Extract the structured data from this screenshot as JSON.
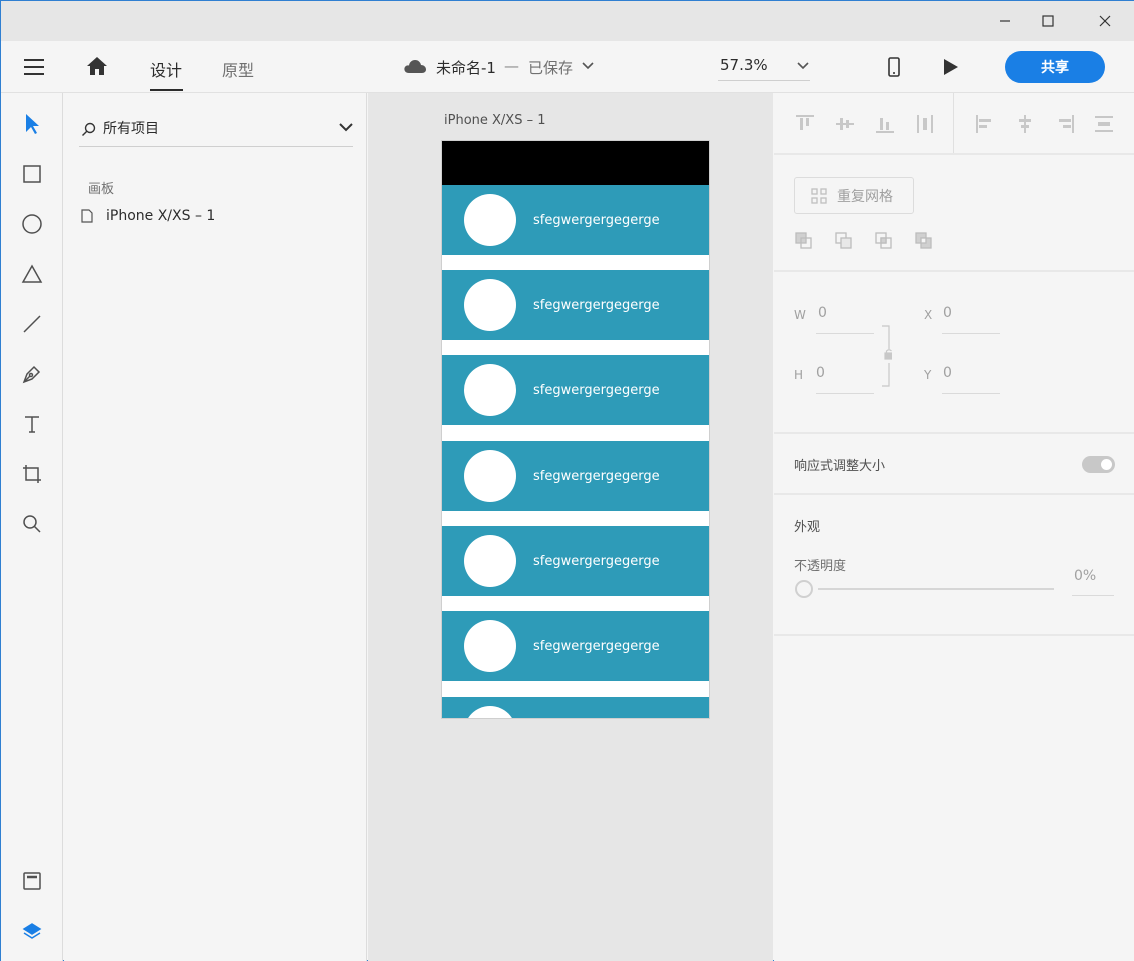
{
  "header": {
    "tabs": [
      "设计",
      "原型"
    ],
    "doc_name": "未命名-1",
    "doc_separator": "—",
    "doc_status": "已保存",
    "zoom": "57.3%",
    "share_label": "共享"
  },
  "layers": {
    "search_label": "所有项目",
    "section_label": "画板",
    "artboard_item": "iPhone X/XS – 1"
  },
  "canvas": {
    "artboard_title": "iPhone X/XS – 1",
    "card_label": "sfegwergergegerge",
    "colors": {
      "card": "#2e9bb8",
      "header": "#000000"
    }
  },
  "props": {
    "repeat_grid_label": "重复网格",
    "w_label": "W",
    "w_value": "0",
    "h_label": "H",
    "h_value": "0",
    "x_label": "X",
    "x_value": "0",
    "y_label": "Y",
    "y_value": "0",
    "responsive_label": "响应式调整大小",
    "appearance_label": "外观",
    "opacity_label": "不透明度",
    "opacity_value": "0%"
  },
  "accent_color": "#1a7fe5"
}
